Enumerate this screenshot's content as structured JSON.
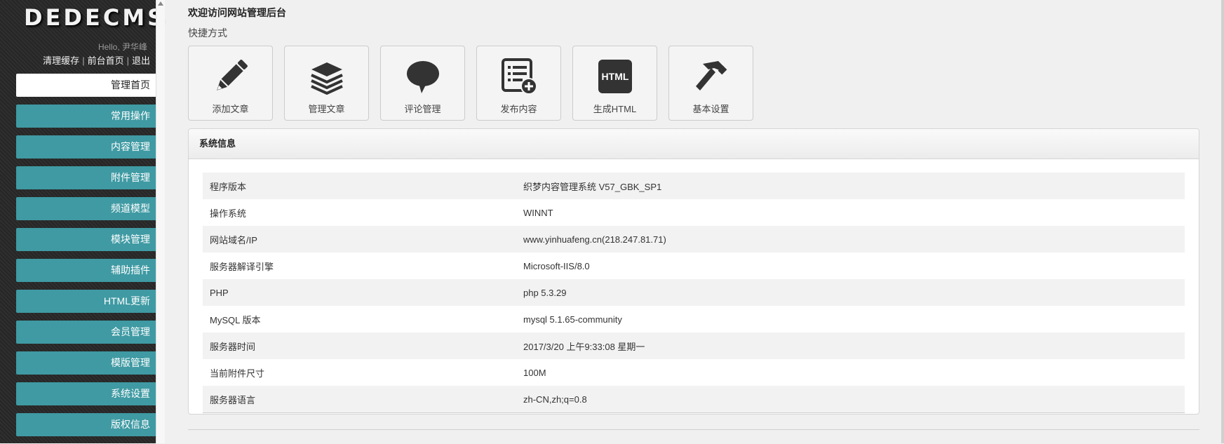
{
  "sidebar": {
    "logo": "DEDECMS",
    "hello_prefix": "Hello, ",
    "username": "尹华峰",
    "links": [
      "清理缓存",
      "前台首页",
      "退出"
    ],
    "menu": [
      "管理首页",
      "常用操作",
      "内容管理",
      "附件管理",
      "频道模型",
      "模块管理",
      "辅助插件",
      "HTML更新",
      "会员管理",
      "模版管理",
      "系统设置",
      "版权信息"
    ]
  },
  "main": {
    "welcome": "欢迎访问网站管理后台",
    "shortcut_title": "快捷方式",
    "shortcuts": [
      {
        "label": "添加文章",
        "icon": "pencil-icon"
      },
      {
        "label": "管理文章",
        "icon": "stack-icon"
      },
      {
        "label": "评论管理",
        "icon": "speech-bubble-icon"
      },
      {
        "label": "发布内容",
        "icon": "list-add-icon"
      },
      {
        "label": "生成HTML",
        "icon": "html-icon",
        "icon_text": "HTML"
      },
      {
        "label": "基本设置",
        "icon": "hammer-icon"
      }
    ],
    "sysinfo": {
      "title": "系统信息",
      "rows": [
        {
          "k": "程序版本",
          "v": "织梦内容管理系统 V57_GBK_SP1"
        },
        {
          "k": "操作系统",
          "v": "WINNT"
        },
        {
          "k": "网站域名/IP",
          "v": "www.yinhuafeng.cn(218.247.81.71)"
        },
        {
          "k": "服务器解译引擎",
          "v": "Microsoft-IIS/8.0"
        },
        {
          "k": "PHP",
          "v": "php 5.3.29"
        },
        {
          "k": "MySQL 版本",
          "v": "mysql 5.1.65-community"
        },
        {
          "k": "服务器时间",
          "v": "2017/3/20 上午9:33:08 星期一"
        },
        {
          "k": "当前附件尺寸",
          "v": "100M"
        },
        {
          "k": "服务器语言",
          "v": "zh-CN,zh;q=0.8"
        }
      ]
    }
  }
}
